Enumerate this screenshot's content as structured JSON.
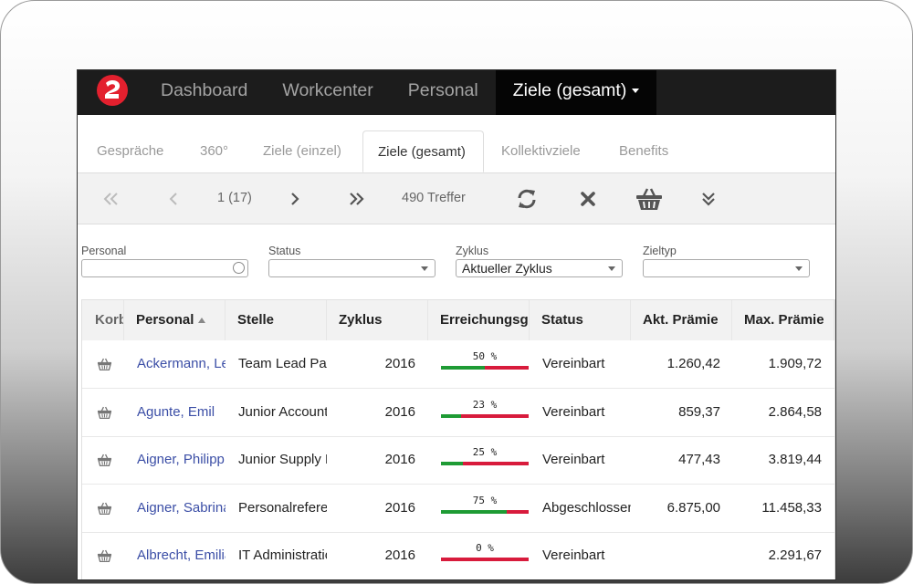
{
  "topnav": {
    "items": [
      "Dashboard",
      "Workcenter",
      "Personal",
      "Ziele (gesamt)"
    ],
    "active_index": 3
  },
  "tabs": {
    "items": [
      "Gespräche",
      "360°",
      "Ziele (einzel)",
      "Ziele (gesamt)",
      "Kollektivziele",
      "Benefits"
    ],
    "active_index": 3
  },
  "toolbar": {
    "page_indicator": "1 (17)",
    "hits": "490 Treffer",
    "icons": [
      "double-chevron-left-icon",
      "chevron-left-icon",
      "chevron-right-icon",
      "double-chevron-right-icon",
      "refresh-icon",
      "clear-x-icon",
      "basket-icon",
      "double-chevron-down-icon"
    ]
  },
  "filters": {
    "personal": {
      "label": "Personal",
      "value": ""
    },
    "status": {
      "label": "Status",
      "value": ""
    },
    "zyklus": {
      "label": "Zyklus",
      "value": "Aktueller Zyklus"
    },
    "zieltyp": {
      "label": "Zieltyp",
      "value": ""
    }
  },
  "table": {
    "columns": [
      "Korb",
      "Personal",
      "Stelle",
      "Zyklus",
      "Erreichungsgrad",
      "Status",
      "Akt. Prämie",
      "Max. Prämie"
    ],
    "rows": [
      {
        "personal": "Ackermann, Lena",
        "stelle": "Team Lead Payroll",
        "zyklus": "2016",
        "pct_label": "50 %",
        "pct": 50,
        "status": "Vereinbart",
        "akt": "1.260,42",
        "max": "1.909,72"
      },
      {
        "personal": "Agunte, Emil",
        "stelle": "Junior Accountant",
        "zyklus": "2016",
        "pct_label": "23 %",
        "pct": 23,
        "status": "Vereinbart",
        "akt": "859,37",
        "max": "2.864,58"
      },
      {
        "personal": "Aigner, Philipp",
        "stelle": "Junior Supply Manager",
        "zyklus": "2016",
        "pct_label": "25 %",
        "pct": 25,
        "status": "Vereinbart",
        "akt": "477,43",
        "max": "3.819,44"
      },
      {
        "personal": "Aigner, Sabrina",
        "stelle": "Personalreferentin",
        "zyklus": "2016",
        "pct_label": "75 %",
        "pct": 75,
        "status": "Abgeschlossen",
        "akt": "6.875,00",
        "max": "11.458,33"
      },
      {
        "personal": "Albrecht, Emilia",
        "stelle": "IT Administration",
        "zyklus": "2016",
        "pct_label": "0 %",
        "pct": 0,
        "status": "Vereinbart",
        "akt": "",
        "max": "2.291,67"
      }
    ]
  },
  "colors": {
    "topbar": "#1c1c1c",
    "link": "#3b4ea6",
    "bar_green": "#1e9b34",
    "bar_red": "#d81b3c",
    "logo": "#e3202e"
  }
}
